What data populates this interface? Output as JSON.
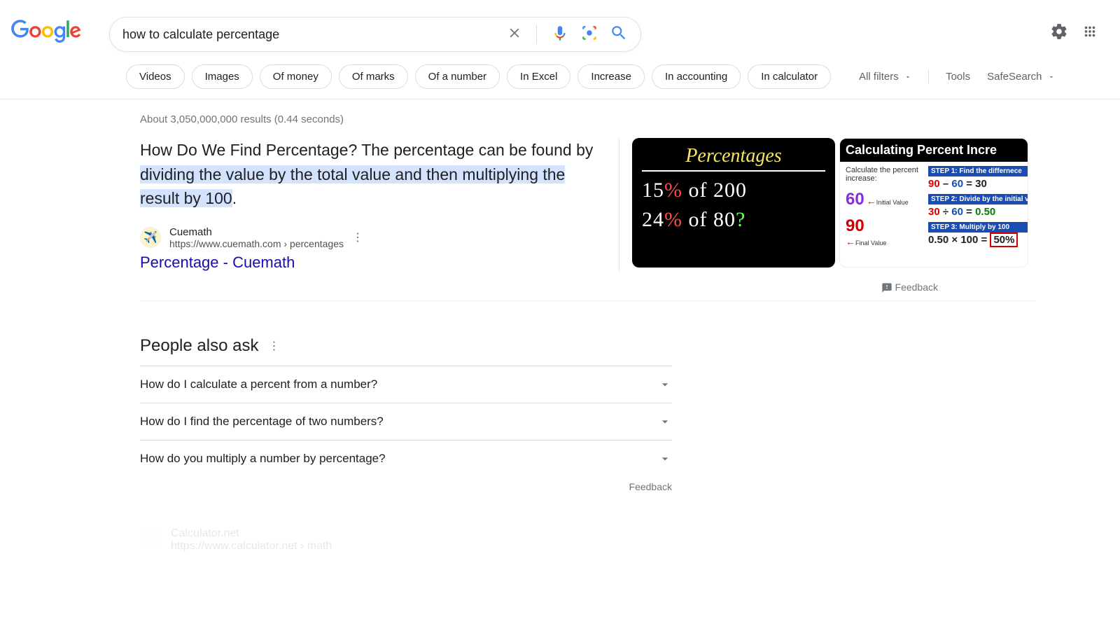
{
  "search": {
    "query": "how to calculate percentage"
  },
  "chips": [
    "Videos",
    "Images",
    "Of money",
    "Of marks",
    "Of a number",
    "In Excel",
    "Increase",
    "In accounting",
    "In calculator"
  ],
  "filters": {
    "all_filters": "All filters",
    "tools": "Tools",
    "safesearch": "SafeSearch"
  },
  "stats": "About 3,050,000,000 results (0.44 seconds)",
  "featured": {
    "text_plain": "How Do We Find Percentage? The percentage can be found by ",
    "text_hl": "dividing the value by the total value and then multiplying the result by 100",
    "text_end": ".",
    "site_name": "Cuemath",
    "site_url": "https://www.cuemath.com › percentages",
    "title": "Percentage - Cuemath"
  },
  "thumb1": {
    "title": "Percentages",
    "line1a": "15",
    "line1b": "%",
    "line1c": " of 200",
    "line2a": "24",
    "line2b": "%",
    "line2c": " of 80",
    "line2d": "?"
  },
  "thumb2": {
    "title": "Calculating Percent Incre",
    "calc_label": "Calculate the percent increase:",
    "v60": "60",
    "v60_tag": "Initial Value",
    "v90": "90",
    "v90_tag": "Final Value",
    "step1": "STEP 1:  Find the differnece",
    "eq1a": "90",
    "eq1b": "–",
    "eq1c": "60",
    "eq1d": "= 30",
    "step2": "STEP 2:  Divide by the initial v",
    "eq2a": "30",
    "eq2b": "÷",
    "eq2c": "60",
    "eq2d": "=",
    "eq2e": "0.50",
    "step3": "STEP 3:  Multiply by 100",
    "eq3a": "0.50",
    "eq3b": "×",
    "eq3c": "100",
    "eq3d": "=",
    "eq3e": "50%"
  },
  "feedback": "Feedback",
  "paa": {
    "title": "People also ask",
    "items": [
      "How do I calculate a percent from a number?",
      "How do I find the percentage of two numbers?",
      "How do you multiply a number by percentage?"
    ],
    "feedback": "Feedback"
  },
  "faded": {
    "name": "Calculator.net",
    "url": "https://www.calculator.net › math"
  }
}
